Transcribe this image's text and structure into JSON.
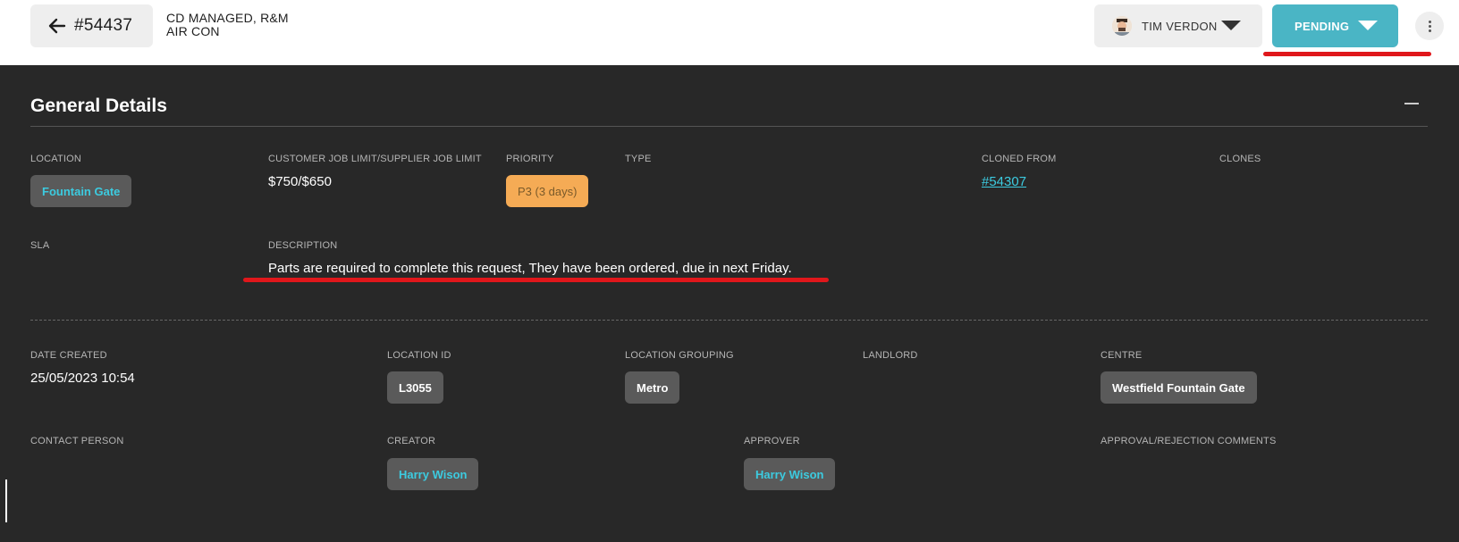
{
  "header": {
    "job_number": "#54437",
    "job_title_line1": "CD MANAGED, R&M",
    "job_title_line2": "AIR CON",
    "assignee": "TIM VERDON",
    "status": "PENDING",
    "status_color": "#4ab5c5"
  },
  "section": {
    "title": "General Details"
  },
  "details": {
    "location_label": "LOCATION",
    "location_value": "Fountain Gate",
    "limit_label": "CUSTOMER JOB LIMIT/SUPPLIER JOB LIMIT",
    "limit_value": "$750/$650",
    "priority_label": "PRIORITY",
    "priority_value": "P3 (3 days)",
    "type_label": "TYPE",
    "cloned_from_label": "CLONED FROM",
    "cloned_from_value": "#54307",
    "clones_label": "CLONES",
    "sla_label": "SLA",
    "description_label": "DESCRIPTION",
    "description_value": "Parts are required to complete this request, They have been ordered, due in next Friday."
  },
  "meta": {
    "date_created_label": "DATE CREATED",
    "date_created_value": "25/05/2023 10:54",
    "location_id_label": "LOCATION ID",
    "location_id_value": "L3055",
    "location_grouping_label": "LOCATION GROUPING",
    "location_grouping_value": "Metro",
    "landlord_label": "LANDLORD",
    "centre_label": "CENTRE",
    "centre_value": "Westfield Fountain Gate",
    "contact_person_label": "CONTACT PERSON",
    "creator_label": "CREATOR",
    "creator_value": "Harry Wison",
    "approver_label": "APPROVER",
    "approver_value": "Harry Wison",
    "approval_comments_label": "APPROVAL/REJECTION COMMENTS"
  }
}
